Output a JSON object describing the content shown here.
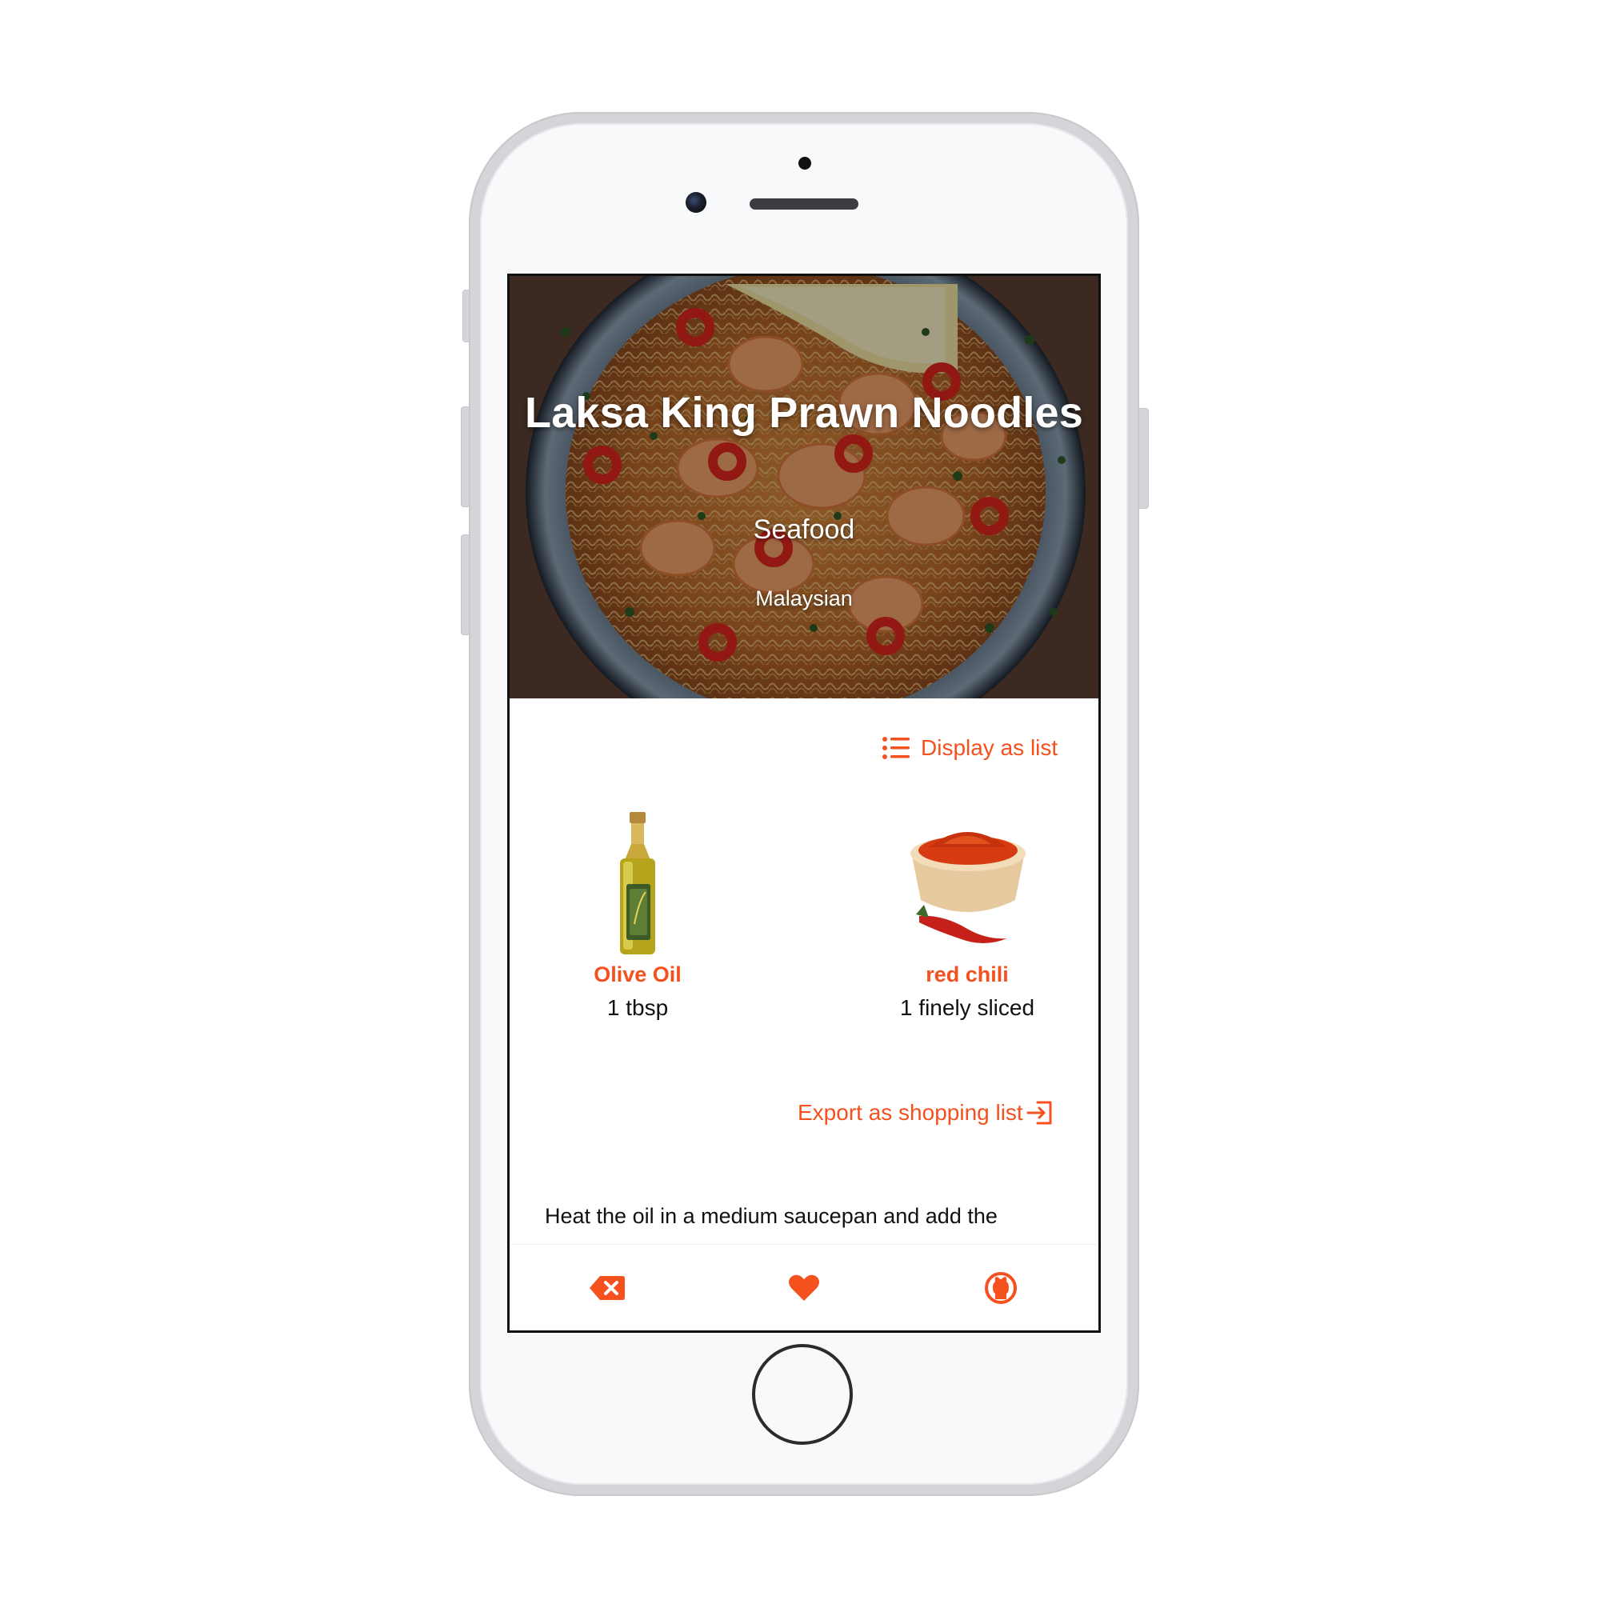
{
  "recipe": {
    "title": "Laksa King Prawn Noodles",
    "category": "Seafood",
    "area": "Malaysian"
  },
  "ingredients_view": {
    "toggle_label": "Display as list",
    "toggle_icon": "list-icon"
  },
  "ingredients": [
    {
      "name": "Olive Oil",
      "measure": "1 tbsp",
      "image": "olive-oil-bottle"
    },
    {
      "name": "red chili",
      "measure": "1 finely sliced",
      "image": "chili-powder-bowl"
    }
  ],
  "export": {
    "label": "Export as shopping list",
    "icon": "export-icon"
  },
  "instructions": {
    "text": "Heat the oil in a medium saucepan and add the"
  },
  "bottom_nav": {
    "items": [
      {
        "icon": "backspace-close-icon"
      },
      {
        "icon": "heart-icon"
      },
      {
        "icon": "github-icon"
      }
    ]
  },
  "colors": {
    "accent": "#f4511e",
    "text": "#111111",
    "phone_frame": "#d4d5d8",
    "phone_body": "#f8f9fb"
  }
}
